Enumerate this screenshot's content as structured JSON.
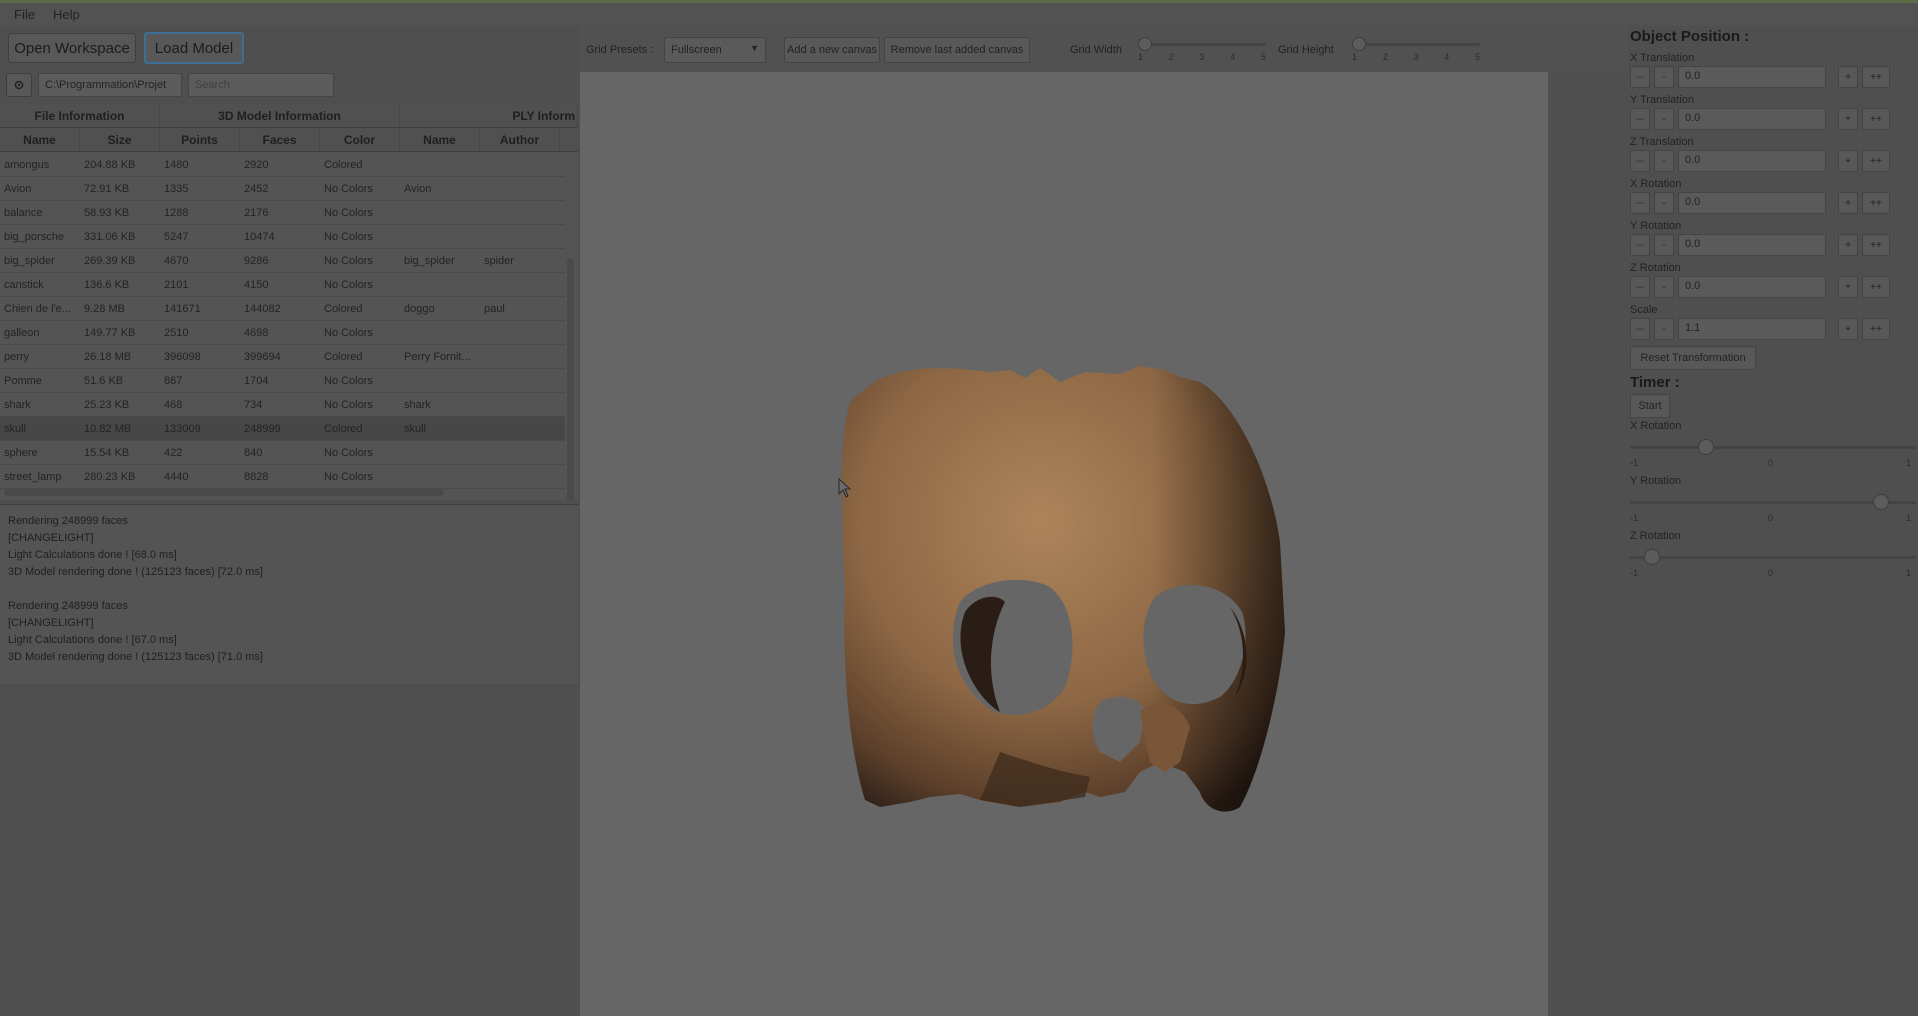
{
  "menu": {
    "file": "File",
    "help": "Help"
  },
  "buttons": {
    "open_workspace": "Open Workspace",
    "load_model": "Load Model"
  },
  "path": {
    "value": "C:\\Programmation\\Projet",
    "search_placeholder": "Search"
  },
  "table": {
    "group_headers": [
      "File Information",
      "3D Model Information",
      "PLY Inform"
    ],
    "columns": [
      "Name",
      "Size",
      "Points",
      "Faces",
      "Color",
      "Name",
      "Author"
    ],
    "rows": [
      {
        "name": "amongus",
        "size": "204.88 KB",
        "points": "1480",
        "faces": "2920",
        "color": "Colored",
        "pname": "",
        "author": ""
      },
      {
        "name": "Avion",
        "size": "72.91 KB",
        "points": "1335",
        "faces": "2452",
        "color": "No Colors",
        "pname": "Avion",
        "author": ""
      },
      {
        "name": "balance",
        "size": "58.93 KB",
        "points": "1288",
        "faces": "2176",
        "color": "No Colors",
        "pname": "",
        "author": ""
      },
      {
        "name": "big_porsche",
        "size": "331.06 KB",
        "points": "5247",
        "faces": "10474",
        "color": "No Colors",
        "pname": "",
        "author": ""
      },
      {
        "name": "big_spider",
        "size": "269.39 KB",
        "points": "4670",
        "faces": "9286",
        "color": "No Colors",
        "pname": "big_spider",
        "author": "spider"
      },
      {
        "name": "canstick",
        "size": "136.6 KB",
        "points": "2101",
        "faces": "4150",
        "color": "No Colors",
        "pname": "",
        "author": ""
      },
      {
        "name": "Chien de l'e...",
        "size": "9.28 MB",
        "points": "141671",
        "faces": "144082",
        "color": "Colored",
        "pname": "doggo",
        "author": "paul"
      },
      {
        "name": "galleon",
        "size": "149.77 KB",
        "points": "2510",
        "faces": "4698",
        "color": "No Colors",
        "pname": "",
        "author": ""
      },
      {
        "name": "perry",
        "size": "26.18 MB",
        "points": "396098",
        "faces": "399694",
        "color": "Colored",
        "pname": "Perry Fornit...",
        "author": ""
      },
      {
        "name": "Pomme",
        "size": "51.6 KB",
        "points": "867",
        "faces": "1704",
        "color": "No Colors",
        "pname": "",
        "author": ""
      },
      {
        "name": "shark",
        "size": "25.23 KB",
        "points": "468",
        "faces": "734",
        "color": "No Colors",
        "pname": "shark",
        "author": ""
      },
      {
        "name": "skull",
        "size": "10.82 MB",
        "points": "133009",
        "faces": "248999",
        "color": "Colored",
        "pname": "skull",
        "author": ""
      },
      {
        "name": "sphere",
        "size": "15.54 KB",
        "points": "422",
        "faces": "840",
        "color": "No Colors",
        "pname": "",
        "author": ""
      },
      {
        "name": "street_lamp",
        "size": "280.23 KB",
        "points": "4440",
        "faces": "8828",
        "color": "No Colors",
        "pname": "",
        "author": ""
      }
    ],
    "selected_index": 11
  },
  "console": [
    "Rendering 248999 faces",
    "[CHANGELIGHT]",
    "Light Calculations done ! [68.0 ms]",
    "3D Model rendering done ! (125123 faces) [72.0 ms]",
    "",
    "Rendering 248999 faces",
    "[CHANGELIGHT]",
    "Light Calculations done ! [67.0 ms]",
    "3D Model rendering done ! (125123 faces) [71.0 ms]"
  ],
  "toolbar": {
    "grid_presets_label": "Grid Presets :",
    "grid_preset_value": "Fullscreen",
    "add_canvas": "Add a new canvas",
    "remove_canvas": "Remove last added canvas",
    "grid_width_label": "Grid Width",
    "grid_height_label": "Grid Height",
    "grid_width_value": 1,
    "grid_height_value": 1,
    "slider_ticks": [
      "1",
      "2",
      "3",
      "4",
      "5"
    ]
  },
  "object_position": {
    "title": "Object Position :",
    "fields": [
      {
        "label": "X Translation",
        "value": "0.0"
      },
      {
        "label": "Y Translation",
        "value": "0.0"
      },
      {
        "label": "Z Translation",
        "value": "0.0"
      },
      {
        "label": "X Rotation",
        "value": "0.0"
      },
      {
        "label": "Y Rotation",
        "value": "0.0"
      },
      {
        "label": "Z Rotation",
        "value": "0.0"
      },
      {
        "label": "Scale",
        "value": "1.1"
      }
    ],
    "btn_dec2": "--",
    "btn_dec1": "-",
    "btn_inc1": "+",
    "btn_inc2": "++",
    "reset": "Reset Transformation"
  },
  "timer": {
    "title": "Timer :",
    "start": "Start",
    "sliders": [
      {
        "label": "X Rotation",
        "value": -0.5
      },
      {
        "label": "Y Rotation",
        "value": 0.8
      },
      {
        "label": "Z Rotation",
        "value": -0.9
      }
    ],
    "tick_labels": [
      "-1",
      "0",
      "1"
    ]
  },
  "viewport": {
    "model": "skull",
    "skull_colors": [
      "#a47d55",
      "#7c5a3c",
      "#3c2a1e"
    ]
  }
}
